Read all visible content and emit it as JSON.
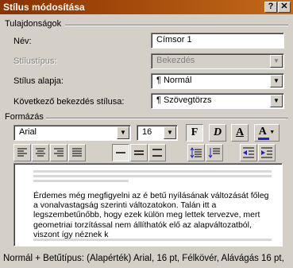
{
  "window": {
    "title": "Stílus módosítása",
    "help_glyph": "?",
    "close_glyph": "✕"
  },
  "properties": {
    "section_label": "Tulajdonságok",
    "name_label": "Név:",
    "name_value": "Címsor 1",
    "style_type_label": "Stílustípus:",
    "style_type_value": "Bekezdés",
    "based_on_label": "Stílus alapja:",
    "based_on_value": "¶  Normál",
    "next_style_label": "Következő bekezdés stílusa:",
    "next_style_value": "¶  Szövegtörzs"
  },
  "formatting": {
    "section_label": "Formázás",
    "font": "Arial",
    "size": "16",
    "bold_glyph": "F",
    "italic_glyph": "D",
    "underline_glyph": "A",
    "font_color_glyph": "A"
  },
  "preview": {
    "text": "Érdemes még megfigyelni az é betű nyílásának változását főleg a vonalvastagság szerinti változatokon. Talán itt a legszembetűnőbb, hogy ezek külön meg lettek tervezve, mert geometriai torzítással nem állíthatók elő az alapváltozatból, viszont így néznek k"
  },
  "description": {
    "text": "Normál + Betűtípus: (Alapérték) Arial, 16 pt, Félkövér, Alávágás 16 pt,"
  },
  "colors": {
    "title_start": "#8a3200",
    "title_end": "#c36a1a",
    "dialog_face": "#d4d0c8",
    "font_color_bar": "#1f1fd0"
  }
}
